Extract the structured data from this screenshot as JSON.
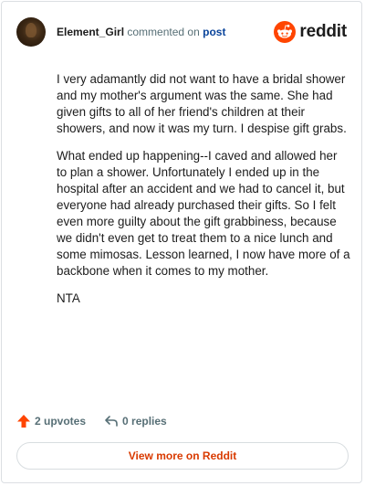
{
  "header": {
    "username": "Element_Girl",
    "commented_text": "commented on",
    "post_link": "post",
    "logo_text": "reddit",
    "avatar_icon": "user-avatar",
    "logo_icon": "reddit-snoo-icon"
  },
  "comment": {
    "paragraphs": [
      "I very adamantly did not want to have a bridal shower and my mother's argument was the same. She had given gifts to all of her friend's children at their showers, and now it was my turn. I despise gift grabs.",
      "What ended up happening--I caved and allowed her to plan a shower. Unfortunately I ended up in the hospital after an accident and we had to cancel it, but everyone had already purchased their gifts. So I felt even more guilty about the gift grabbiness, because we didn't even get to treat them to a nice lunch and some mimosas. Lesson learned, I now have more of a backbone when it comes to my mother.",
      "NTA"
    ]
  },
  "actions": {
    "upvotes_label": "2 upvotes",
    "replies_label": "0 replies",
    "upvote_icon": "upvote-arrow-icon",
    "reply_icon": "reply-arrow-icon"
  },
  "footer": {
    "view_more_label": "View more on Reddit"
  },
  "colors": {
    "brand_orange": "#ff4500",
    "link_blue": "#0a449b",
    "view_more_text": "#d93a00",
    "muted_text": "#576f76"
  }
}
